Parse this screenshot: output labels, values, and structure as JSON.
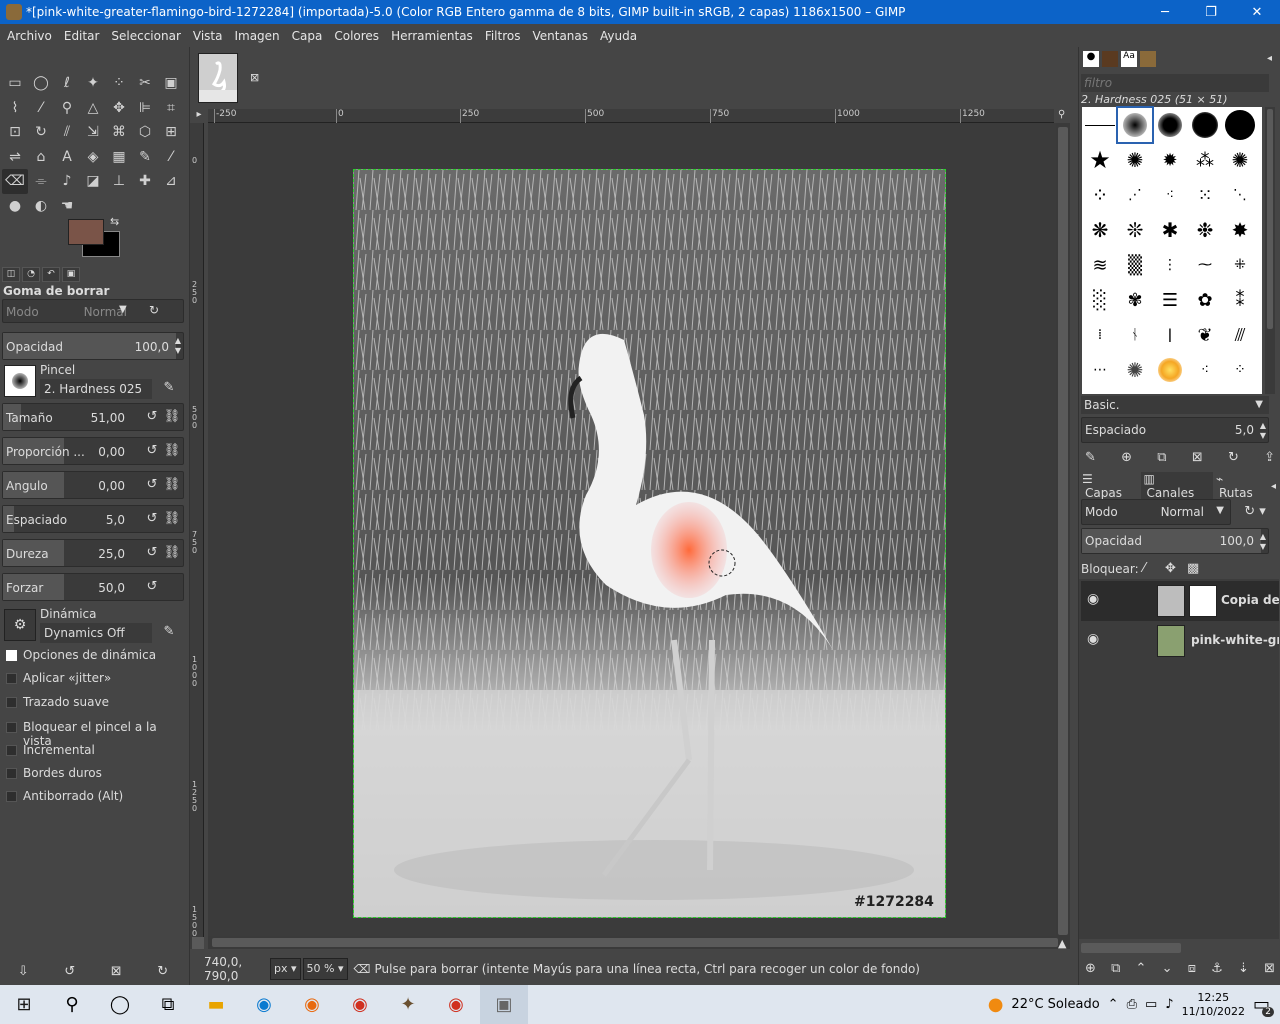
{
  "window": {
    "title": "*[pink-white-greater-flamingo-bird-1272284] (importada)-5.0 (Color RGB Entero gamma de 8 bits, GIMP built-in sRGB, 2 capas) 1186x1500 – GIMP",
    "minimize": "─",
    "restore": "❐",
    "close": "✕"
  },
  "menu": [
    "Archivo",
    "Editar",
    "Seleccionar",
    "Vista",
    "Imagen",
    "Capa",
    "Colores",
    "Herramientas",
    "Filtros",
    "Ventanas",
    "Ayuda"
  ],
  "tool_options": {
    "title": "Goma de borrar",
    "mode_label": "Modo",
    "mode_value": "Normal",
    "opacity_label": "Opacidad",
    "opacity_value": "100,0",
    "opacity_fill": 1.0,
    "brush_label": "Pincel",
    "brush_value": "2. Hardness 025",
    "size_label": "Tamaño",
    "size_value": "51,00",
    "size_fill": 0.1,
    "ratio_label": "Proporción ...",
    "ratio_value": "0,00",
    "ratio_fill": 0.5,
    "angle_label": "Angulo",
    "angle_value": "0,00",
    "angle_fill": 0.5,
    "spacing_label": "Espaciado",
    "spacing_value": "5,0",
    "spacing_fill": 0.08,
    "hardness_label": "Dureza",
    "hardness_value": "25,0",
    "hardness_fill": 0.25,
    "force_label": "Forzar",
    "force_value": "50,0",
    "force_fill": 0.5,
    "dynamics_label": "Dinámica",
    "dynamics_value": "Dynamics Off",
    "dynamics_options": "Opciones de dinámica",
    "checks": [
      "Aplicar «jitter»",
      "Trazado suave",
      "Bloquear el pincel a la vista",
      "Incremental",
      "Bordes duros",
      "Antiborrado  (Alt)"
    ]
  },
  "rulers": {
    "h": [
      "-250",
      "0",
      "250",
      "500",
      "750",
      "1000",
      "1250"
    ],
    "v": [
      "0",
      "250",
      "500",
      "750",
      "1000",
      "1250",
      "1500"
    ]
  },
  "image": {
    "watermark": "#1272284"
  },
  "status": {
    "coords": "740,0, 790,0",
    "unit": "px",
    "zoom": "50 %",
    "message": "Pulse para borrar (intente Mayús para una línea recta, Ctrl para recoger un color de fondo)"
  },
  "brushes_panel": {
    "filter_placeholder": "filtro",
    "selected": "2. Hardness 025 (51 × 51)",
    "tag": "Basic.",
    "spacing_label": "Espaciado",
    "spacing_value": "5,0"
  },
  "layers_panel": {
    "tabs": [
      "Capas",
      "Canales",
      "Rutas"
    ],
    "mode_label": "Modo",
    "mode_value": "Normal",
    "opacity_label": "Opacidad",
    "opacity_value": "100,0",
    "lock_label": "Bloquear:",
    "layers": [
      {
        "name": "Copia de"
      },
      {
        "name": "pink-white-gr"
      }
    ]
  },
  "taskbar": {
    "weather": "22°C  Soleado",
    "time": "12:25",
    "date": "11/10/2022",
    "notifications": "2"
  }
}
